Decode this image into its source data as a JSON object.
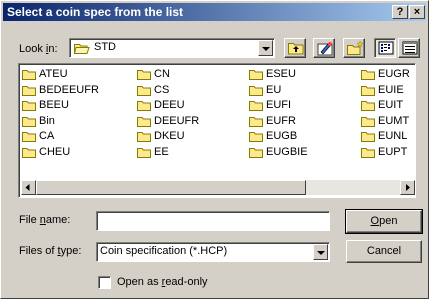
{
  "dialog": {
    "title": "Select a coin spec from the list",
    "help_label": "?",
    "close_label": "×"
  },
  "lookin": {
    "label": "Look in:",
    "label_underline": "i",
    "label_after": "n:",
    "label_before": "Look ",
    "value": "STD"
  },
  "files": [
    [
      "ATEU",
      "BEDEEUFR",
      "BEEU",
      "Bin",
      "CA",
      "CHEU"
    ],
    [
      "CN",
      "CS",
      "DEEU",
      "DEEUFR",
      "DKEU",
      "EE"
    ],
    [
      "ESEU",
      "EU",
      "EUFI",
      "EUFR",
      "EUGB",
      "EUGBIE"
    ],
    [
      "EUGR",
      "EUIE",
      "EUIT",
      "EUMT",
      "EUNL",
      "EUPT"
    ]
  ],
  "filename": {
    "label_before": "File ",
    "label_underline": "n",
    "label_after": "ame:",
    "value": ""
  },
  "filetype": {
    "label_before": "Files of ",
    "label_underline": "t",
    "label_after": "ype:",
    "value": "Coin specification (*.HCP)"
  },
  "readonly": {
    "label_before": "Open as ",
    "label_underline": "r",
    "label_after": "ead-only",
    "checked": false
  },
  "buttons": {
    "open_underline": "O",
    "open_rest": "pen",
    "cancel": "Cancel"
  },
  "colors": {
    "folder": "#ffe88c",
    "title_start": "#0a246a",
    "title_end": "#a6caf0"
  }
}
